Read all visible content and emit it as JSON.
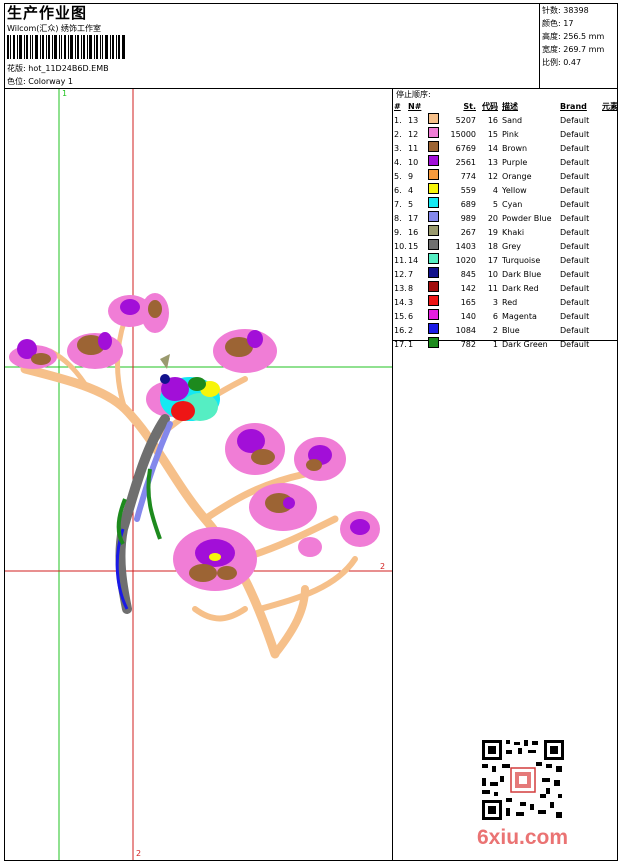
{
  "header": {
    "title": "生产作业图",
    "company": "Wilcom(汇众) 绣饰工作室",
    "pattern_label": "花版:",
    "pattern_value": "hot_11D24B6D.EMB",
    "colorway_label": "色位:",
    "colorway_value": "Colorway 1"
  },
  "stats": {
    "stitches": "针数: 38398",
    "colors": "颜色: 17",
    "height": "高度: 256.5 mm",
    "width": "宽度: 269.7 mm",
    "scale": "比例: 0.47"
  },
  "stop_sequence_label": "停止顺序:",
  "table": {
    "headers": [
      "#",
      "N#",
      "St.",
      "代码",
      "描述",
      "Brand",
      "元素"
    ],
    "rows": [
      {
        "idx": "1.",
        "n": "13",
        "color": "#f6c08a",
        "st": "5207",
        "code": "16",
        "desc": "Sand",
        "brand": "Default"
      },
      {
        "idx": "2.",
        "n": "12",
        "color": "#f07dd6",
        "st": "15000",
        "code": "15",
        "desc": "Pink",
        "brand": "Default"
      },
      {
        "idx": "3.",
        "n": "11",
        "color": "#9c6434",
        "st": "6769",
        "code": "14",
        "desc": "Brown",
        "brand": "Default"
      },
      {
        "idx": "4.",
        "n": "10",
        "color": "#a20fd8",
        "st": "2561",
        "code": "13",
        "desc": "Purple",
        "brand": "Default"
      },
      {
        "idx": "5.",
        "n": "9",
        "color": "#f79a3d",
        "st": "774",
        "code": "12",
        "desc": "Orange",
        "brand": "Default"
      },
      {
        "idx": "6.",
        "n": "4",
        "color": "#f7f50a",
        "st": "559",
        "code": "4",
        "desc": "Yellow",
        "brand": "Default"
      },
      {
        "idx": "7.",
        "n": "5",
        "color": "#14e9f2",
        "st": "689",
        "code": "5",
        "desc": "Cyan",
        "brand": "Default"
      },
      {
        "idx": "8.",
        "n": "17",
        "color": "#8488ec",
        "st": "989",
        "code": "20",
        "desc": "Powder Blue",
        "brand": "Default"
      },
      {
        "idx": "9.",
        "n": "16",
        "color": "#9a9a6e",
        "st": "267",
        "code": "19",
        "desc": "Khaki",
        "brand": "Default"
      },
      {
        "idx": "10.",
        "n": "15",
        "color": "#6f6f6f",
        "st": "1403",
        "code": "18",
        "desc": "Grey",
        "brand": "Default"
      },
      {
        "idx": "11.",
        "n": "14",
        "color": "#55eec3",
        "st": "1020",
        "code": "17",
        "desc": "Turquoise",
        "brand": "Default"
      },
      {
        "idx": "12.",
        "n": "7",
        "color": "#12128c",
        "st": "845",
        "code": "10",
        "desc": "Dark Blue",
        "brand": "Default"
      },
      {
        "idx": "13.",
        "n": "8",
        "color": "#a20d0d",
        "st": "142",
        "code": "11",
        "desc": "Dark Red",
        "brand": "Default"
      },
      {
        "idx": "14.",
        "n": "3",
        "color": "#ee1515",
        "st": "165",
        "code": "3",
        "desc": "Red",
        "brand": "Default"
      },
      {
        "idx": "15.",
        "n": "6",
        "color": "#e61fe0",
        "st": "140",
        "code": "6",
        "desc": "Magenta",
        "brand": "Default"
      },
      {
        "idx": "16.",
        "n": "2",
        "color": "#1a1ae6",
        "st": "1084",
        "code": "2",
        "desc": "Blue",
        "brand": "Default"
      },
      {
        "idx": "17.",
        "n": "1",
        "color": "#1d8a1d",
        "st": "782",
        "code": "1",
        "desc": "Dark Green",
        "brand": "Default"
      }
    ]
  },
  "guides": {
    "green_top": "1",
    "red_right": "2",
    "red_bottom": "2"
  },
  "watermark": "6xiu.com"
}
